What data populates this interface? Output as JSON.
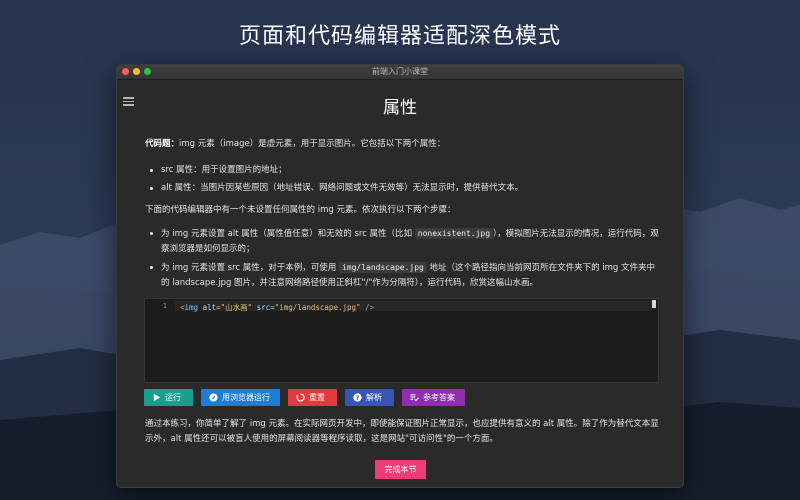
{
  "headline": "页面和代码编辑器适配深色模式",
  "window": {
    "title": "前端入门小课堂"
  },
  "page": {
    "title": "属性",
    "intro_label": "代码题：",
    "intro_text": "img 元素（image）是虚元素，用于显示图片。它包括以下两个属性：",
    "attrs": [
      "src 属性：用于设置图片的地址；",
      "alt 属性：当图片因某些原因（地址错误、网络问题或文件无效等）无法显示时，提供替代文本。"
    ],
    "task_intro": "下面的代码编辑器中有一个未设置任何属性的 img 元素。依次执行以下两个步骤：",
    "steps": [
      {
        "pre": "为 img 元素设置 alt 属性（属性值任意）和无效的 src 属性（比如 ",
        "code": "nonexistent.jpg",
        "post": "），模拟图片无法显示的情况，运行代码，观察浏览器是如何显示的；"
      },
      {
        "pre": "为 img 元素设置 src 属性，对于本例，可使用 ",
        "code": "img/landscape.jpg",
        "post": " 地址（这个路径指向当前网页所在文件夹下的 img 文件夹中的 landscape.jpg 图片，并注意网络路径使用正斜杠\"/\"作为分隔符），运行代码，欣赏这幅山水画。"
      }
    ],
    "summary": "通过本练习，你简单了解了 img 元素。在实际网页开发中，即使能保证图片正常显示，也应提供有意义的 alt 属性。除了作为替代文本显示外，alt 属性还可以被盲人使用的屏幕阅读器等程序读取，这是网站\"可访问性\"的一个方面。"
  },
  "editor": {
    "line_number": "1",
    "tokens": {
      "open": "<",
      "tag": "img",
      "alt_attr": " alt",
      "eq1": "=",
      "alt_val": "\"山水画\"",
      "src_attr": " src",
      "eq2": "=",
      "src_val": "\"img/landscape.jpg\"",
      "close": " />"
    }
  },
  "buttons": {
    "run": "运行",
    "browser": "用浏览器运行",
    "reset": "重置",
    "explain": "解析",
    "answer": "参考答案",
    "done": "完成本节"
  },
  "colors": {
    "run": "#15a08f",
    "browser": "#1e7bd6",
    "reset": "#e43a3f",
    "explain": "#3a56b5",
    "answer": "#8e2fb0",
    "done": "#f23b76"
  },
  "icons": {
    "menu": "hamburger-menu-icon",
    "run": "play-icon",
    "browser": "compass-icon",
    "reset": "reset-icon",
    "explain": "question-icon",
    "answer": "list-check-icon"
  }
}
